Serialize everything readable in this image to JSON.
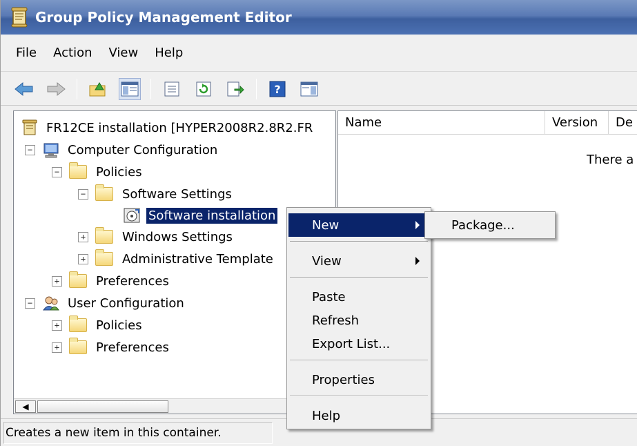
{
  "window": {
    "title": "Group Policy Management Editor"
  },
  "menubar": {
    "items": [
      "File",
      "Action",
      "View",
      "Help"
    ]
  },
  "toolbar": {
    "buttons": [
      "back-icon",
      "forward-icon",
      "up-folder-icon",
      "show-hide-tree-icon",
      "properties-icon",
      "refresh-icon",
      "export-list-icon",
      "help-icon",
      "show-action-pane-icon"
    ]
  },
  "tree": {
    "root": "FR12CE installation [HYPER2008R2.8R2.FR",
    "computer_config": "Computer Configuration",
    "cc_policies": "Policies",
    "software_settings": "Software Settings",
    "software_installation": "Software installation",
    "windows_settings": "Windows Settings",
    "admin_templates": "Administrative Template",
    "cc_preferences": "Preferences",
    "user_config": "User Configuration",
    "uc_policies": "Policies",
    "uc_preferences": "Preferences",
    "expander_expanded": "−",
    "expander_collapsed": "+"
  },
  "list": {
    "columns": [
      "Name",
      "Version",
      "De"
    ],
    "empty_message": "There a"
  },
  "context_menu": {
    "new": "New",
    "view": "View",
    "paste": "Paste",
    "refresh": "Refresh",
    "export_list": "Export List...",
    "properties": "Properties",
    "help": "Help"
  },
  "submenu": {
    "package": "Package..."
  },
  "statusbar": {
    "text": "Creates a new item in this container."
  },
  "colors": {
    "title_bar": "#4c71b3",
    "selection": "#0a246a"
  }
}
